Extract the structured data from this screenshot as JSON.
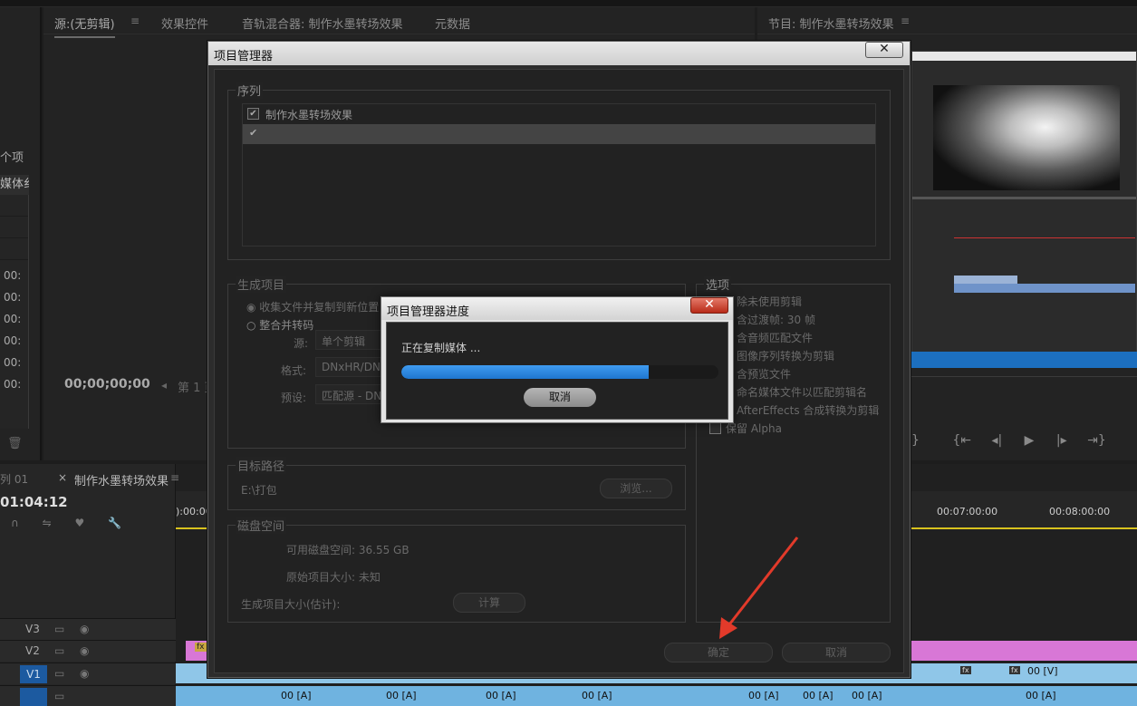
{
  "source_panel": {
    "tabs": [
      "源:(无剪辑)",
      "效果控件",
      "音轨混合器: 制作水墨转场效果",
      "元数据"
    ],
    "timecode": "00;00;00;00",
    "page_label": "第 1 页"
  },
  "program_panel": {
    "tab": "节目: 制作水墨转场效果"
  },
  "left_panel": {
    "item_count": "个项",
    "media_col": "媒体纟",
    "rows": [
      "00:",
      "00:",
      "00:",
      "00:",
      "00:",
      "00:"
    ]
  },
  "timeline": {
    "tab_prev": "列 01",
    "tab_active": "制作水墨转场效果",
    "timecode": "01:04:12",
    "ruler": [
      "):00:00",
      "00:07:00:00",
      "00:08:00:00"
    ],
    "tracks": [
      "V3",
      "V2",
      "V1"
    ],
    "clip_labels": [
      "00 [V]",
      "00 [A]",
      "00 [A]",
      "00 [A]",
      "00 [A]",
      "00 [A]",
      "00 [A]",
      "00 [A]",
      "00 [A]"
    ],
    "fx_label": "fx"
  },
  "project_manager": {
    "title": "项目管理器",
    "close_label": "✕",
    "sequence_legend": "序列",
    "sequences": [
      {
        "name": "制作水墨转场效果",
        "checked": true
      },
      {
        "name": "",
        "checked": true
      }
    ],
    "generate_legend": "生成项目",
    "radio_collect": "收集文件并复制到新位置",
    "radio_consolidate": "整合并转码",
    "source_label": "源:",
    "source_value": "单个剪辑",
    "format_label": "格式:",
    "format_value": "DNxHR/DNx",
    "preset_label": "预设:",
    "preset_value": "匹配源 - DN",
    "options_legend": "选项",
    "options": [
      "除未使用剪辑",
      "含过渡帧:  30 帧",
      "含音频匹配文件",
      "图像序列转换为剪辑",
      "含预览文件",
      "命名媒体文件以匹配剪辑名",
      "AfterEffects 合成转换为剪辑",
      "保留 Alpha"
    ],
    "dest_legend": "目标路径",
    "dest_path": "E:\\打包",
    "browse_label": "浏览...",
    "disk_legend": "磁盘空间",
    "available_space": "可用磁盘空间: 36.55 GB",
    "original_size": "原始项目大小: 未知",
    "generated_size": "生成项目大小(估计):",
    "calc_label": "计算",
    "ok_label": "确定",
    "cancel_label": "取消"
  },
  "progress_dialog": {
    "title": "项目管理器进度",
    "close_label": "✕",
    "status": "正在复制媒体 ...",
    "progress": 0.78,
    "cancel_label": "取消"
  },
  "annotation_arrow_color": "#e23a2a"
}
